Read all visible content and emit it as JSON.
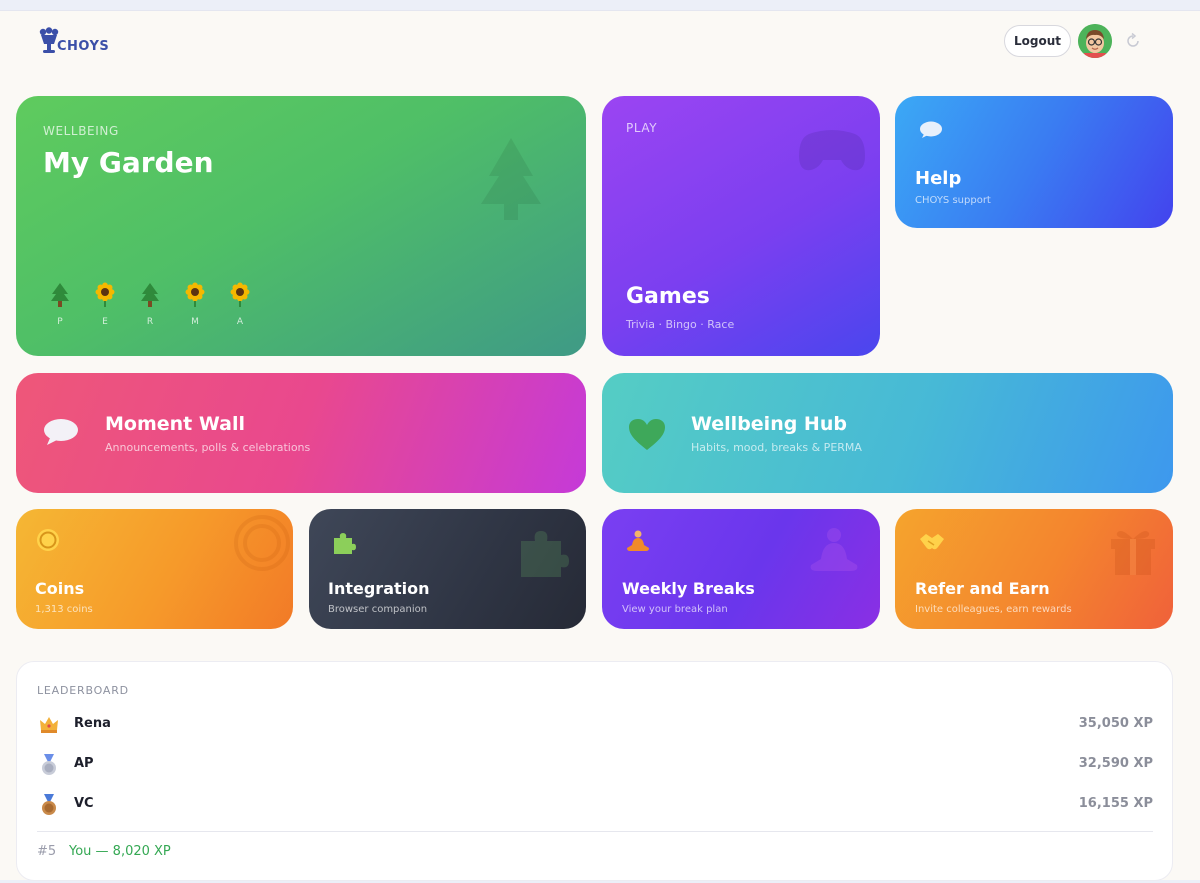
{
  "header": {
    "logo_text": "CHOYS",
    "logout_label": "Logout"
  },
  "garden": {
    "eyebrow": "WELLBEING",
    "title": "My Garden",
    "plants": [
      {
        "label": "P",
        "icon": "tree-icon"
      },
      {
        "label": "E",
        "icon": "sunflower-icon"
      },
      {
        "label": "R",
        "icon": "tree-icon"
      },
      {
        "label": "M",
        "icon": "sunflower-icon"
      },
      {
        "label": "A",
        "icon": "sunflower-icon"
      }
    ]
  },
  "games": {
    "eyebrow": "PLAY",
    "title": "Games",
    "subtitle": "Trivia · Bingo · Race"
  },
  "help": {
    "title": "Help",
    "subtitle": "CHOYS support"
  },
  "moment_wall": {
    "title": "Moment Wall",
    "subtitle": "Announcements, polls & celebrations"
  },
  "wellbeing_hub": {
    "title": "Wellbeing Hub",
    "subtitle": "Habits, mood, breaks & PERMA"
  },
  "coins": {
    "title": "Coins",
    "subtitle": "1,313 coins"
  },
  "integration": {
    "title": "Integration",
    "subtitle": "Browser companion"
  },
  "weekly_breaks": {
    "title": "Weekly Breaks",
    "subtitle": "View your break plan"
  },
  "refer": {
    "title": "Refer and Earn",
    "subtitle": "Invite colleagues, earn rewards"
  },
  "leaderboard": {
    "heading": "LEADERBOARD",
    "rows": [
      {
        "name": "Rena",
        "xp": "35,050 XP",
        "medal": "crown-icon"
      },
      {
        "name": "AP",
        "xp": "32,590 XP",
        "medal": "silver-medal-icon"
      },
      {
        "name": "VC",
        "xp": "16,155 XP",
        "medal": "bronze-medal-icon"
      }
    ],
    "you_rank": "#5",
    "you_text": "You — 8,020 XP"
  },
  "colors": {
    "brand": "#3b4fa8",
    "you_highlight": "#34a853"
  }
}
